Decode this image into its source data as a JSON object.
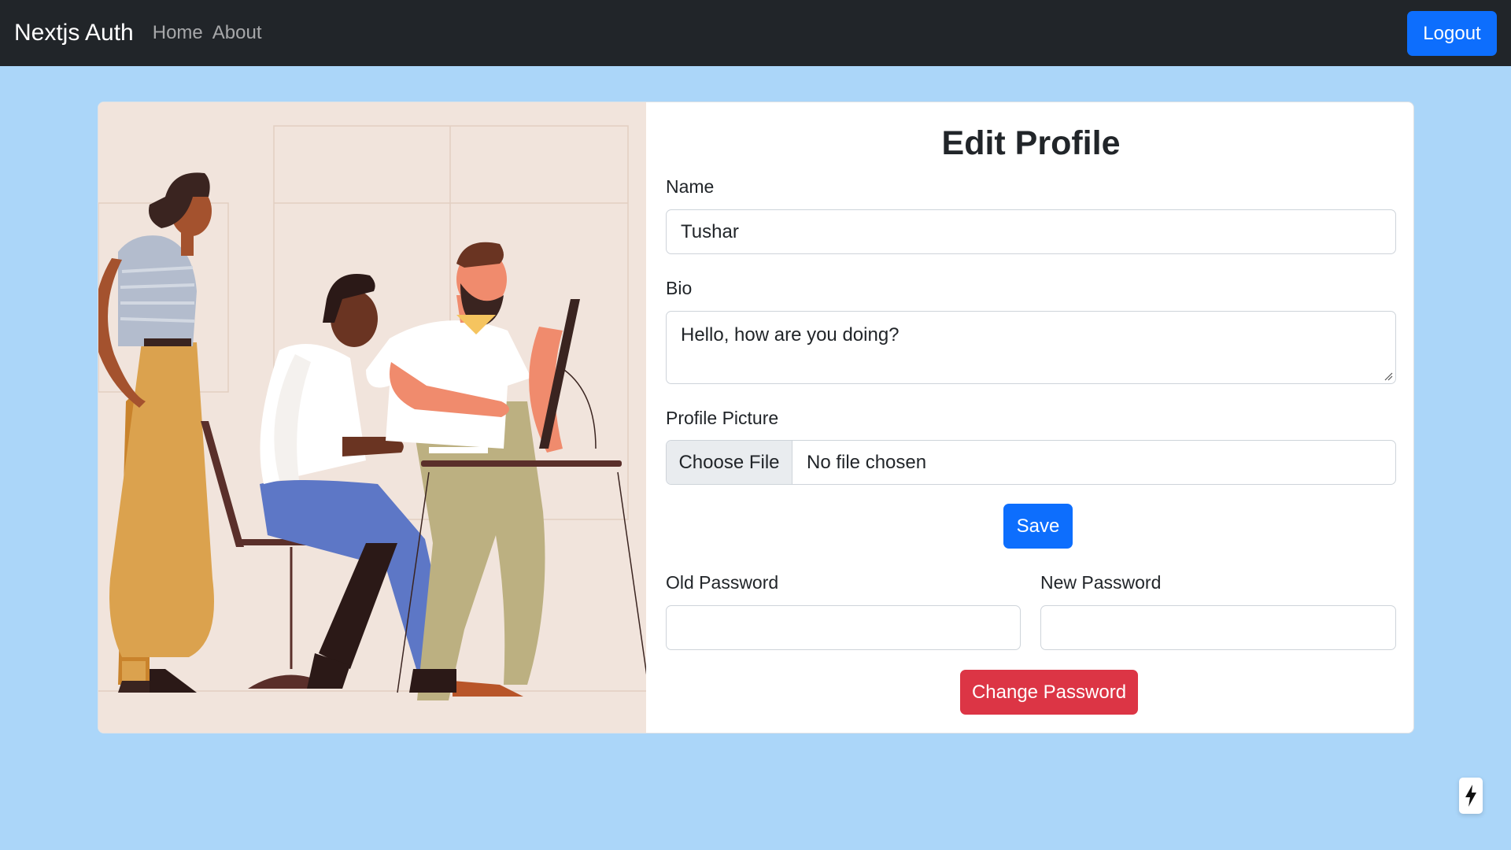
{
  "navbar": {
    "brand": "Nextjs Auth",
    "links": [
      {
        "label": "Home"
      },
      {
        "label": "About"
      }
    ],
    "logout_label": "Logout"
  },
  "form": {
    "title": "Edit Profile",
    "name_label": "Name",
    "name_value": "Tushar",
    "bio_label": "Bio",
    "bio_value": "Hello, how are you doing?",
    "picture_label": "Profile Picture",
    "choose_file_label": "Choose File",
    "file_status": "No file chosen",
    "save_label": "Save",
    "old_password_label": "Old Password",
    "old_password_value": "",
    "new_password_label": "New Password",
    "new_password_value": "",
    "change_password_label": "Change Password"
  },
  "colors": {
    "page_bg": "#abd6f9",
    "navbar_bg": "#212529",
    "primary": "#0d6efd",
    "danger": "#dc3545",
    "illustration_bg": "#f1e4dc"
  },
  "icons": {
    "next_indicator": "lightning-bolt-icon"
  }
}
